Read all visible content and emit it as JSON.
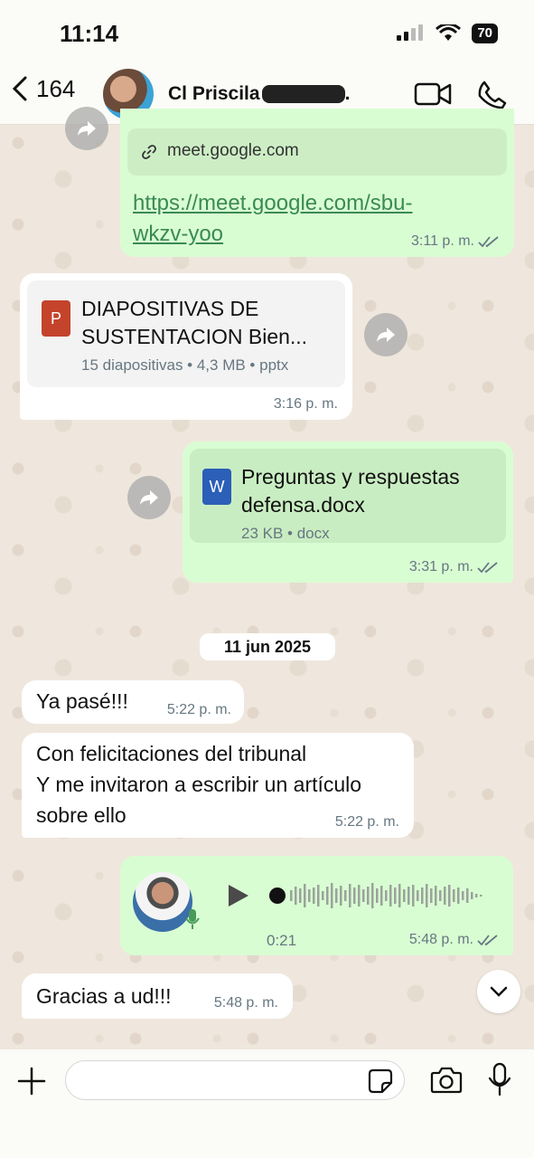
{
  "status": {
    "time": "11:14",
    "battery": "70"
  },
  "header": {
    "back_count": "164",
    "contact_name": "Cl Priscila",
    "contact_suffix": "."
  },
  "messages": {
    "link": {
      "domain": "meet.google.com",
      "url_line1": "https://meet.google.com/sbu-",
      "url_line2": "wkzv-yoo",
      "time": "3:11 p. m."
    },
    "pptx": {
      "title_line1": "DIAPOSITIVAS DE",
      "title_line2": "SUSTENTACION Bien...",
      "details": "15 diapositivas • 4,3 MB • pptx",
      "time": "3:16 p. m.",
      "icon_letter": "P"
    },
    "docx": {
      "title_line1": "Preguntas y respuestas",
      "title_line2": "defensa.docx",
      "details": "23 KB • docx",
      "time": "3:31 p. m.",
      "icon_letter": "W"
    },
    "date": "11 jun 2025",
    "m1": {
      "text": "Ya pasé!!!",
      "time": "5:22 p. m."
    },
    "m2": {
      "line1": "Con felicitaciones del tribunal",
      "line2": "Y me invitaron a escribir un artículo",
      "line3": "sobre ello",
      "time": "5:22 p. m."
    },
    "voice": {
      "duration": "0:21",
      "time": "5:48 p. m."
    },
    "m3": {
      "text": "Gracias a ud!!!",
      "time": "5:48 p. m."
    }
  },
  "colors": {
    "outgoing": "#d9fdd3",
    "incoming": "#ffffff",
    "link": "#027eb5",
    "ppt": "#c4432b",
    "word": "#2b5fb8"
  }
}
